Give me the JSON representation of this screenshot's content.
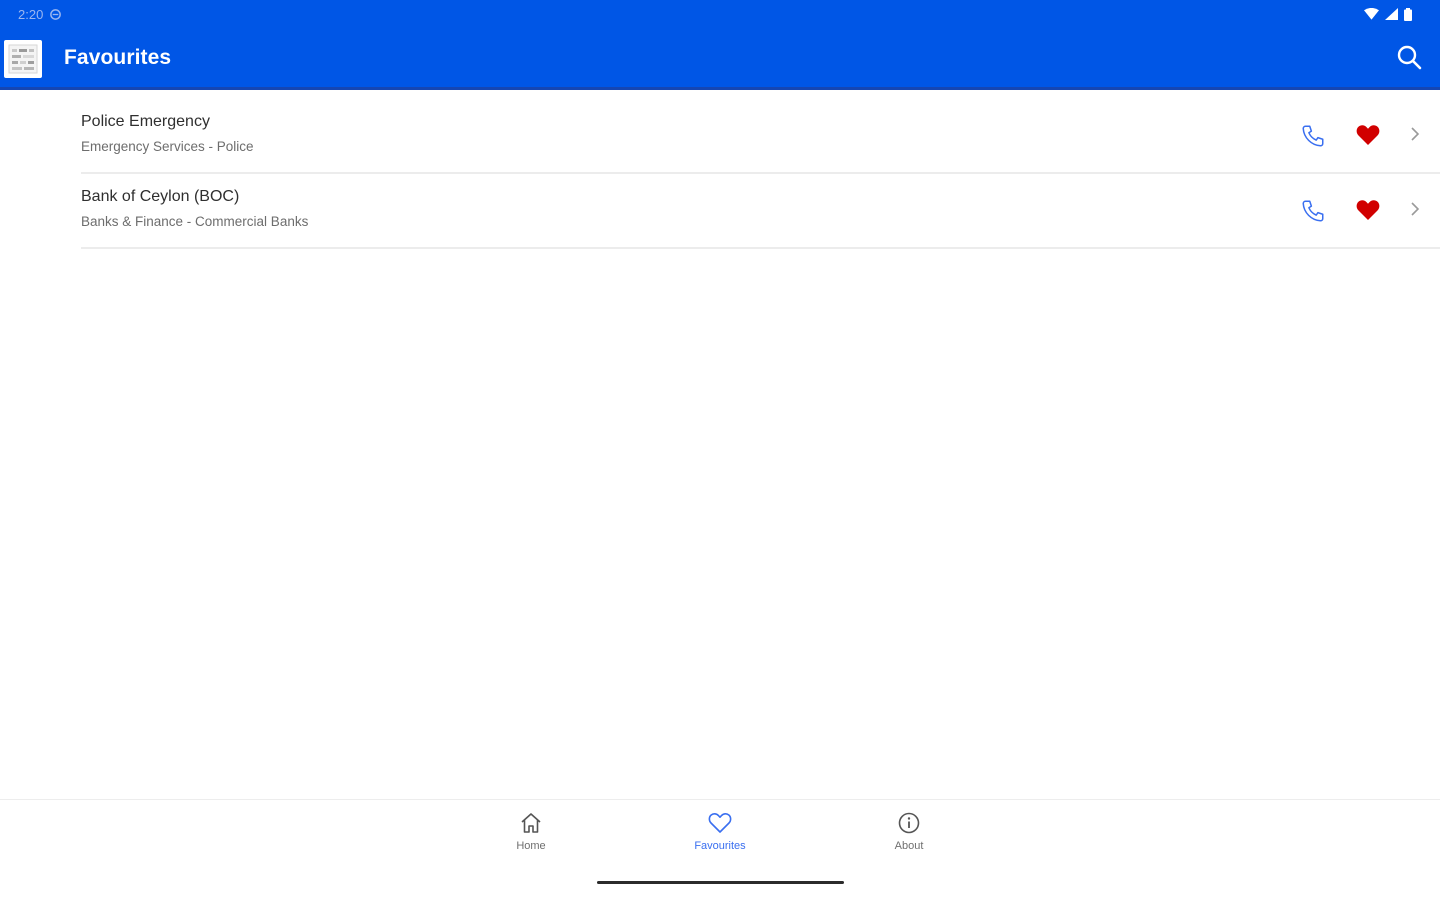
{
  "status_bar": {
    "time": "2:20",
    "left_icon": "sync-icon",
    "right_icons": [
      "wifi-icon",
      "signal-icon",
      "battery-icon"
    ]
  },
  "app_bar": {
    "title": "Favourites",
    "logo_icon": "app-logo-icon",
    "search_icon": "search-icon",
    "background_color": "#0056e6"
  },
  "favourites": [
    {
      "title": "Police Emergency",
      "subtitle": "Emergency Services - Police"
    },
    {
      "title": "Bank of Ceylon (BOC)",
      "subtitle": "Banks & Finance - Commercial Banks"
    }
  ],
  "item_icons": {
    "call": "phone-icon",
    "favourite": "heart-filled-icon",
    "open": "chevron-right-icon"
  },
  "colors": {
    "accent": "#3a6ff0",
    "heart": "#d10000",
    "brand": "#0056e6"
  },
  "bottom_nav": {
    "items": [
      {
        "label": "Home",
        "icon": "home-icon",
        "active": false
      },
      {
        "label": "Favourites",
        "icon": "heart-outline-icon",
        "active": true
      },
      {
        "label": "About",
        "icon": "info-icon",
        "active": false
      }
    ]
  }
}
